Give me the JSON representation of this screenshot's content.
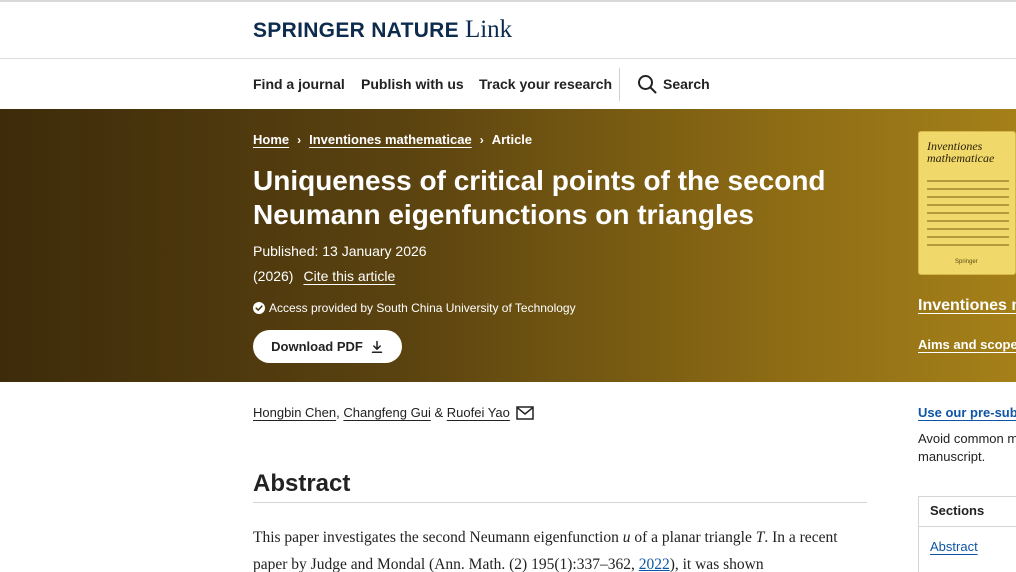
{
  "brand": {
    "main": "SPRINGER NATURE",
    "link": "Link"
  },
  "nav": {
    "items": [
      "Find a journal",
      "Publish with us",
      "Track your research"
    ],
    "search_label": "Search"
  },
  "breadcrumb": {
    "home": "Home",
    "journal": "Inventiones mathematicae",
    "current": "Article",
    "separator": "›"
  },
  "article": {
    "title": "Uniqueness of critical points of the second Neumann eigenfunctions on triangles",
    "published": "Published: 13 January 2026",
    "year": "(2026)",
    "cite_label": "Cite this article",
    "access_text": "Access provided by South China University of Technology",
    "download_label": "Download PDF",
    "authors": [
      "Hongbin Chen",
      "Changfeng Gui",
      "Ruofei Yao"
    ],
    "author_sep_1": ",",
    "author_sep_2": "&"
  },
  "journal_sidebar": {
    "cover_title": "Inventiones mathematicae",
    "cover_publisher": "Springer",
    "name": "Inventiones m",
    "aims_label": "Aims and scope"
  },
  "side": {
    "preprint_link": "Use our pre-sub",
    "avoid_line_1": "Avoid common m",
    "avoid_line_2": "manuscript.",
    "sections_heading": "Sections",
    "sections_link": "Abstract"
  },
  "abstract": {
    "heading": "Abstract",
    "part1": "This paper investigates the second Neumann eigenfunction ",
    "var_u": "u",
    "part2": " of a planar triangle ",
    "var_T": "T",
    "part3": ". In a recent paper by Judge and Mondal (Ann. Math. (2) 195(1):337–362, ",
    "year_link": "2022",
    "part4": "), it was shown"
  },
  "colors": {
    "hero_start": "#3d2b0a",
    "hero_end": "#a58019",
    "brand": "#0d2b4d",
    "link": "#0d55a5"
  },
  "icons": [
    "search-icon",
    "chevron-right-icon",
    "check-circle-icon",
    "download-icon",
    "mail-icon"
  ]
}
